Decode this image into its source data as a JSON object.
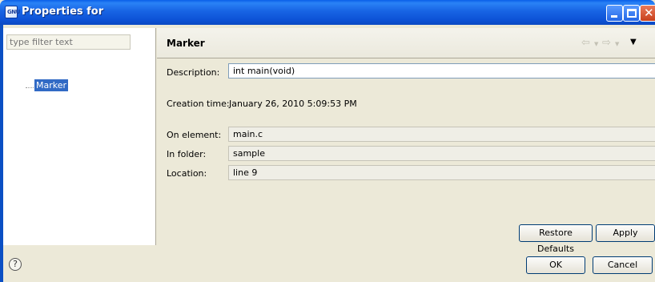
{
  "window": {
    "title": "Properties for"
  },
  "filter": {
    "placeholder": "type filter text"
  },
  "tree": {
    "items": [
      {
        "label": "Marker"
      }
    ]
  },
  "page": {
    "title": "Marker"
  },
  "fields": {
    "description": {
      "label": "Description:",
      "value": "int main(void)"
    },
    "creation_time": {
      "label": "Creation time:",
      "value": "January 26, 2010 5:09:53 PM"
    },
    "on_element": {
      "label": "On element:",
      "value": "main.c"
    },
    "in_folder": {
      "label": "In folder:",
      "value": "sample"
    },
    "location": {
      "label": "Location:",
      "value": "line 9"
    }
  },
  "buttons": {
    "restore_defaults": "Restore Defaults",
    "apply": "Apply",
    "ok": "OK",
    "cancel": "Cancel"
  },
  "icons": {
    "help": "?",
    "back": "⇦",
    "back_dropdown": "▼",
    "forward": "⇨",
    "forward_dropdown": "▼",
    "view_menu": "▼",
    "close": "✕"
  }
}
